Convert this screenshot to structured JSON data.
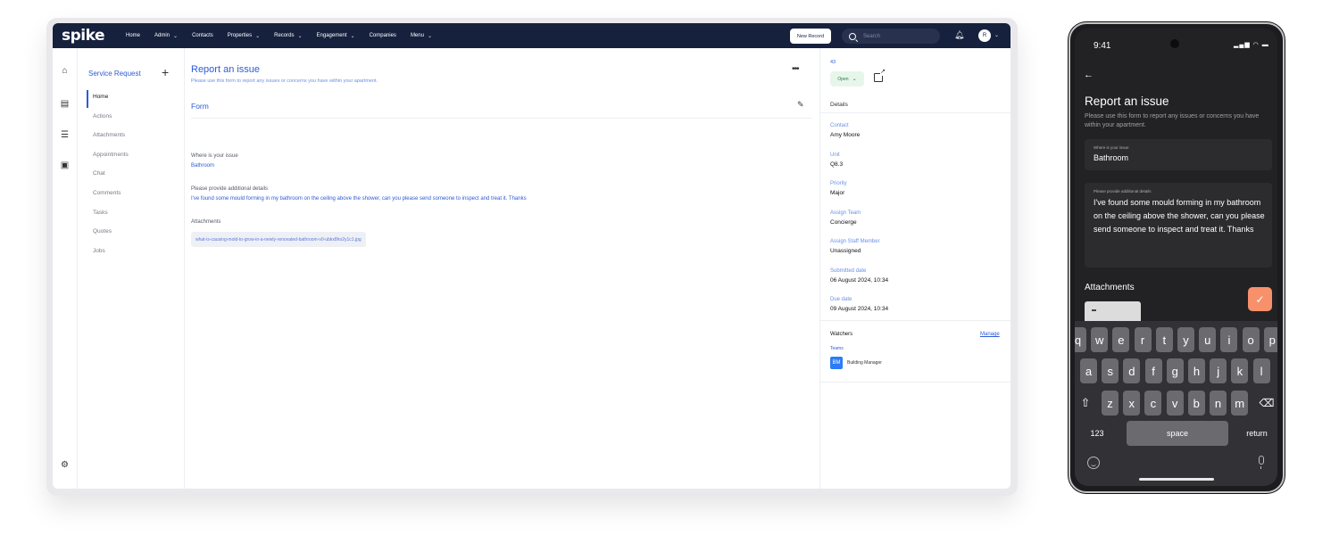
{
  "desktop": {
    "logo": "spike",
    "nav": [
      {
        "label": "Home",
        "chevron": false
      },
      {
        "label": "Admin",
        "chevron": true
      },
      {
        "label": "Contacts",
        "chevron": false
      },
      {
        "label": "Properties",
        "chevron": true
      },
      {
        "label": "Records",
        "chevron": true
      },
      {
        "label": "Engagement",
        "chevron": true
      },
      {
        "label": "Companies",
        "chevron": false
      },
      {
        "label": "Menu",
        "chevron": true
      }
    ],
    "new_record_label": "New Record",
    "search_placeholder": "Search",
    "avatar_initial": "R",
    "subnav": {
      "title": "Service Request",
      "items": [
        "Home",
        "Actions",
        "Attachments",
        "Appointments",
        "Chat",
        "Comments",
        "Tasks",
        "Quotes",
        "Jobs"
      ]
    },
    "main": {
      "title": "Report an issue",
      "subtitle": "Please use this form to report any issues or concerns you have within your apartment.",
      "form_title": "Form",
      "fields": [
        {
          "label": "Where is your issue",
          "value": "Bathroom"
        },
        {
          "label": "Please provide additional details",
          "value": "I've found some mould forming in my bathroom on the ceiling above the shower, can you please send someone to inspect and treat it. Thanks"
        }
      ],
      "attachments_label": "Attachments",
      "attachment_file": "what-is-causing-mold-to-grow-in-a-newly-renovated-bathroom-v0-ubkx8ho2y1c1.jpg"
    },
    "details": {
      "id": "43",
      "status": "Open",
      "heading": "Details",
      "fields": [
        {
          "label": "Contact",
          "value": "Amy Moore"
        },
        {
          "label": "Unit",
          "value": "Q8.3"
        },
        {
          "label": "Priority",
          "value": "Major"
        },
        {
          "label": "Assign Team",
          "value": "Concierge"
        },
        {
          "label": "Assign Staff Member",
          "value": "Unassigned"
        },
        {
          "label": "Submitted date",
          "value": "06 August 2024, 10:34"
        },
        {
          "label": "Due date",
          "value": "09 August 2024, 10:34"
        }
      ],
      "watchers_label": "Watchers",
      "manage_label": "Manage",
      "teams_label": "Teams",
      "team_badge": "BM",
      "team_name": "Building Manager"
    }
  },
  "phone": {
    "time": "9:41",
    "title": "Report an issue",
    "subtitle": "Please use this form to report any issues or concerns you have within your apartment.",
    "issue_label": "Where is your issue",
    "issue_value": "Bathroom",
    "details_label": "Please provide additional details",
    "details_value": "I've found some mould forming in my bathroom on the ceiling above the shower, can you please send someone to inspect and treat it. Thanks",
    "attachments_label": "Attachments",
    "keyboard": {
      "row1": [
        "q",
        "w",
        "e",
        "r",
        "t",
        "y",
        "u",
        "i",
        "o",
        "p"
      ],
      "row2": [
        "a",
        "s",
        "d",
        "f",
        "g",
        "h",
        "j",
        "k",
        "l"
      ],
      "row3": [
        "z",
        "x",
        "c",
        "v",
        "b",
        "n",
        "m"
      ],
      "numbers": "123",
      "space": "space",
      "return": "return"
    }
  }
}
